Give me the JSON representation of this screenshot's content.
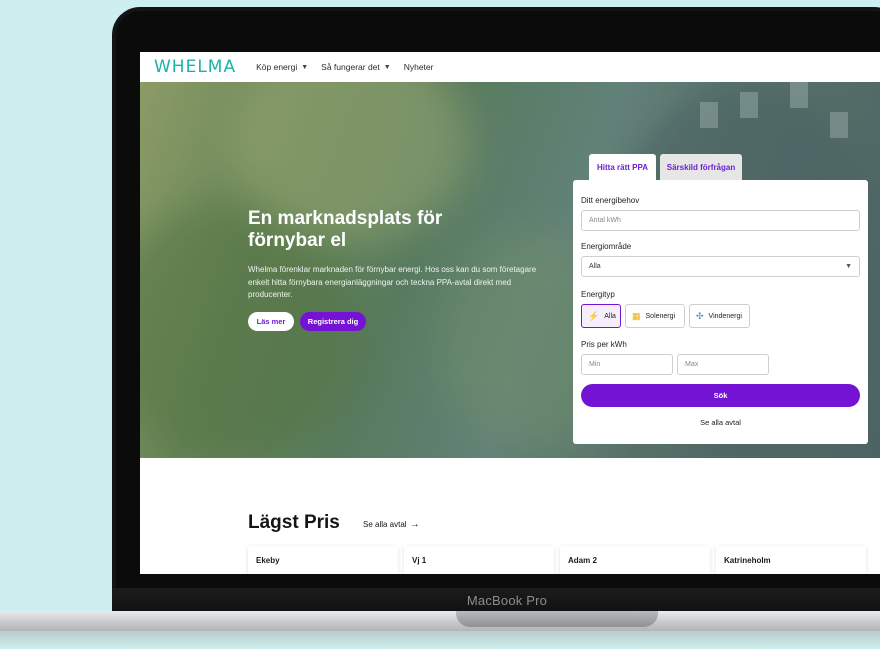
{
  "device": {
    "label": "MacBook Pro"
  },
  "nav": {
    "logo": "WHELMA",
    "items": [
      {
        "label": "Köp energi",
        "dropdown": true
      },
      {
        "label": "Så fungerar det",
        "dropdown": true
      },
      {
        "label": "Nyheter",
        "dropdown": false
      }
    ]
  },
  "hero": {
    "title": "En marknadsplats för förnybar el",
    "description": "Whelma förenklar marknaden för förnybar energi. Hos oss kan du som företagare enkelt hitta förnybara energianläggningar och teckna PPA-avtal direkt med producenter.",
    "btn_read_more": "Läs mer",
    "btn_register": "Registrera dig"
  },
  "search": {
    "tabs": [
      {
        "label": "Hitta rätt PPA",
        "active": true
      },
      {
        "label": "Särskild förfrågan",
        "active": false
      }
    ],
    "need_label": "Ditt energibehov",
    "need_placeholder": "Antal kWh",
    "area_label": "Energiområde",
    "area_value": "Alla",
    "type_label": "Energityp",
    "types": [
      {
        "label": "Alla",
        "icon": "bolt-icon",
        "selected": true
      },
      {
        "label": "Solenergi",
        "icon": "solar-panel-icon",
        "selected": false
      },
      {
        "label": "Vindenergi",
        "icon": "wind-turbine-icon",
        "selected": false
      }
    ],
    "price_label": "Pris per kWh",
    "min_placeholder": "Min",
    "max_placeholder": "Max",
    "search_button": "Sök",
    "see_all": "Se alla avtal"
  },
  "lowest": {
    "title": "Lägst Pris",
    "see_all": "Se alla avtal",
    "cards": [
      "Ekeby",
      "Vj 1",
      "Adam 2",
      "Katrineholm"
    ]
  },
  "colors": {
    "brand": "#19b3a8",
    "accent": "#7413d4"
  }
}
